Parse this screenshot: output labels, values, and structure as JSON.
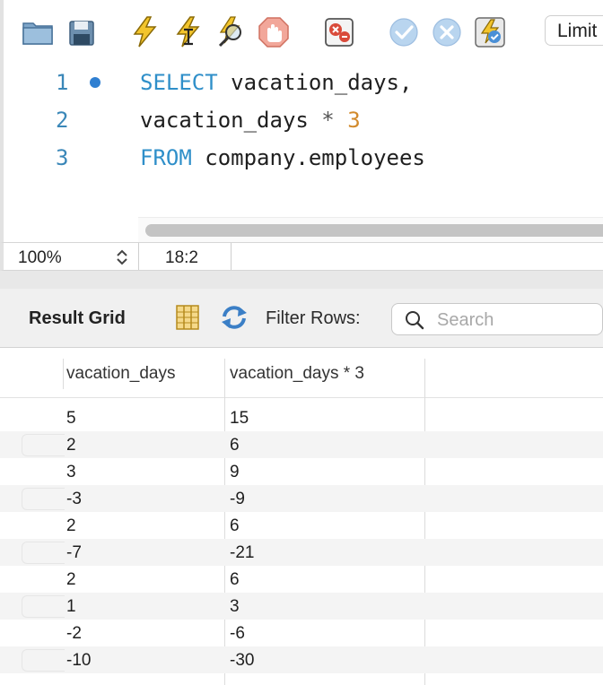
{
  "toolbar": {
    "icons": [
      "open-folder-icon",
      "save-icon",
      "execute-icon",
      "execute-current-icon",
      "explain-icon",
      "stop-icon",
      "toggle-error-icon",
      "commit-icon",
      "rollback-icon",
      "autocommit-icon"
    ],
    "limit_label": "Limit"
  },
  "editor": {
    "line_numbers": [
      "1",
      "2",
      "3"
    ],
    "lines": [
      {
        "keyword": "SELECT",
        "rest": " vacation_days,"
      },
      {
        "plain": "vacation_days ",
        "operator": "*",
        "space": " ",
        "number": "3"
      },
      {
        "keyword": "FROM",
        "rest": " company.employees"
      }
    ]
  },
  "status": {
    "zoom": "100%",
    "cursor": "18:2"
  },
  "results": {
    "title": "Result Grid",
    "filter_label": "Filter Rows:",
    "search_placeholder": "Search",
    "columns": [
      "vacation_days",
      "vacation_days * 3"
    ],
    "rows": [
      [
        "5",
        "15"
      ],
      [
        "2",
        "6"
      ],
      [
        "3",
        "9"
      ],
      [
        "-3",
        "-9"
      ],
      [
        "2",
        "6"
      ],
      [
        "-7",
        "-21"
      ],
      [
        "2",
        "6"
      ],
      [
        "1",
        "3"
      ],
      [
        "-2",
        "-6"
      ],
      [
        "-10",
        "-30"
      ]
    ]
  },
  "colors": {
    "keyword": "#2f8fc9",
    "number": "#d28a2c",
    "line_number": "#3a87b8",
    "marker": "#2f7fd1"
  }
}
